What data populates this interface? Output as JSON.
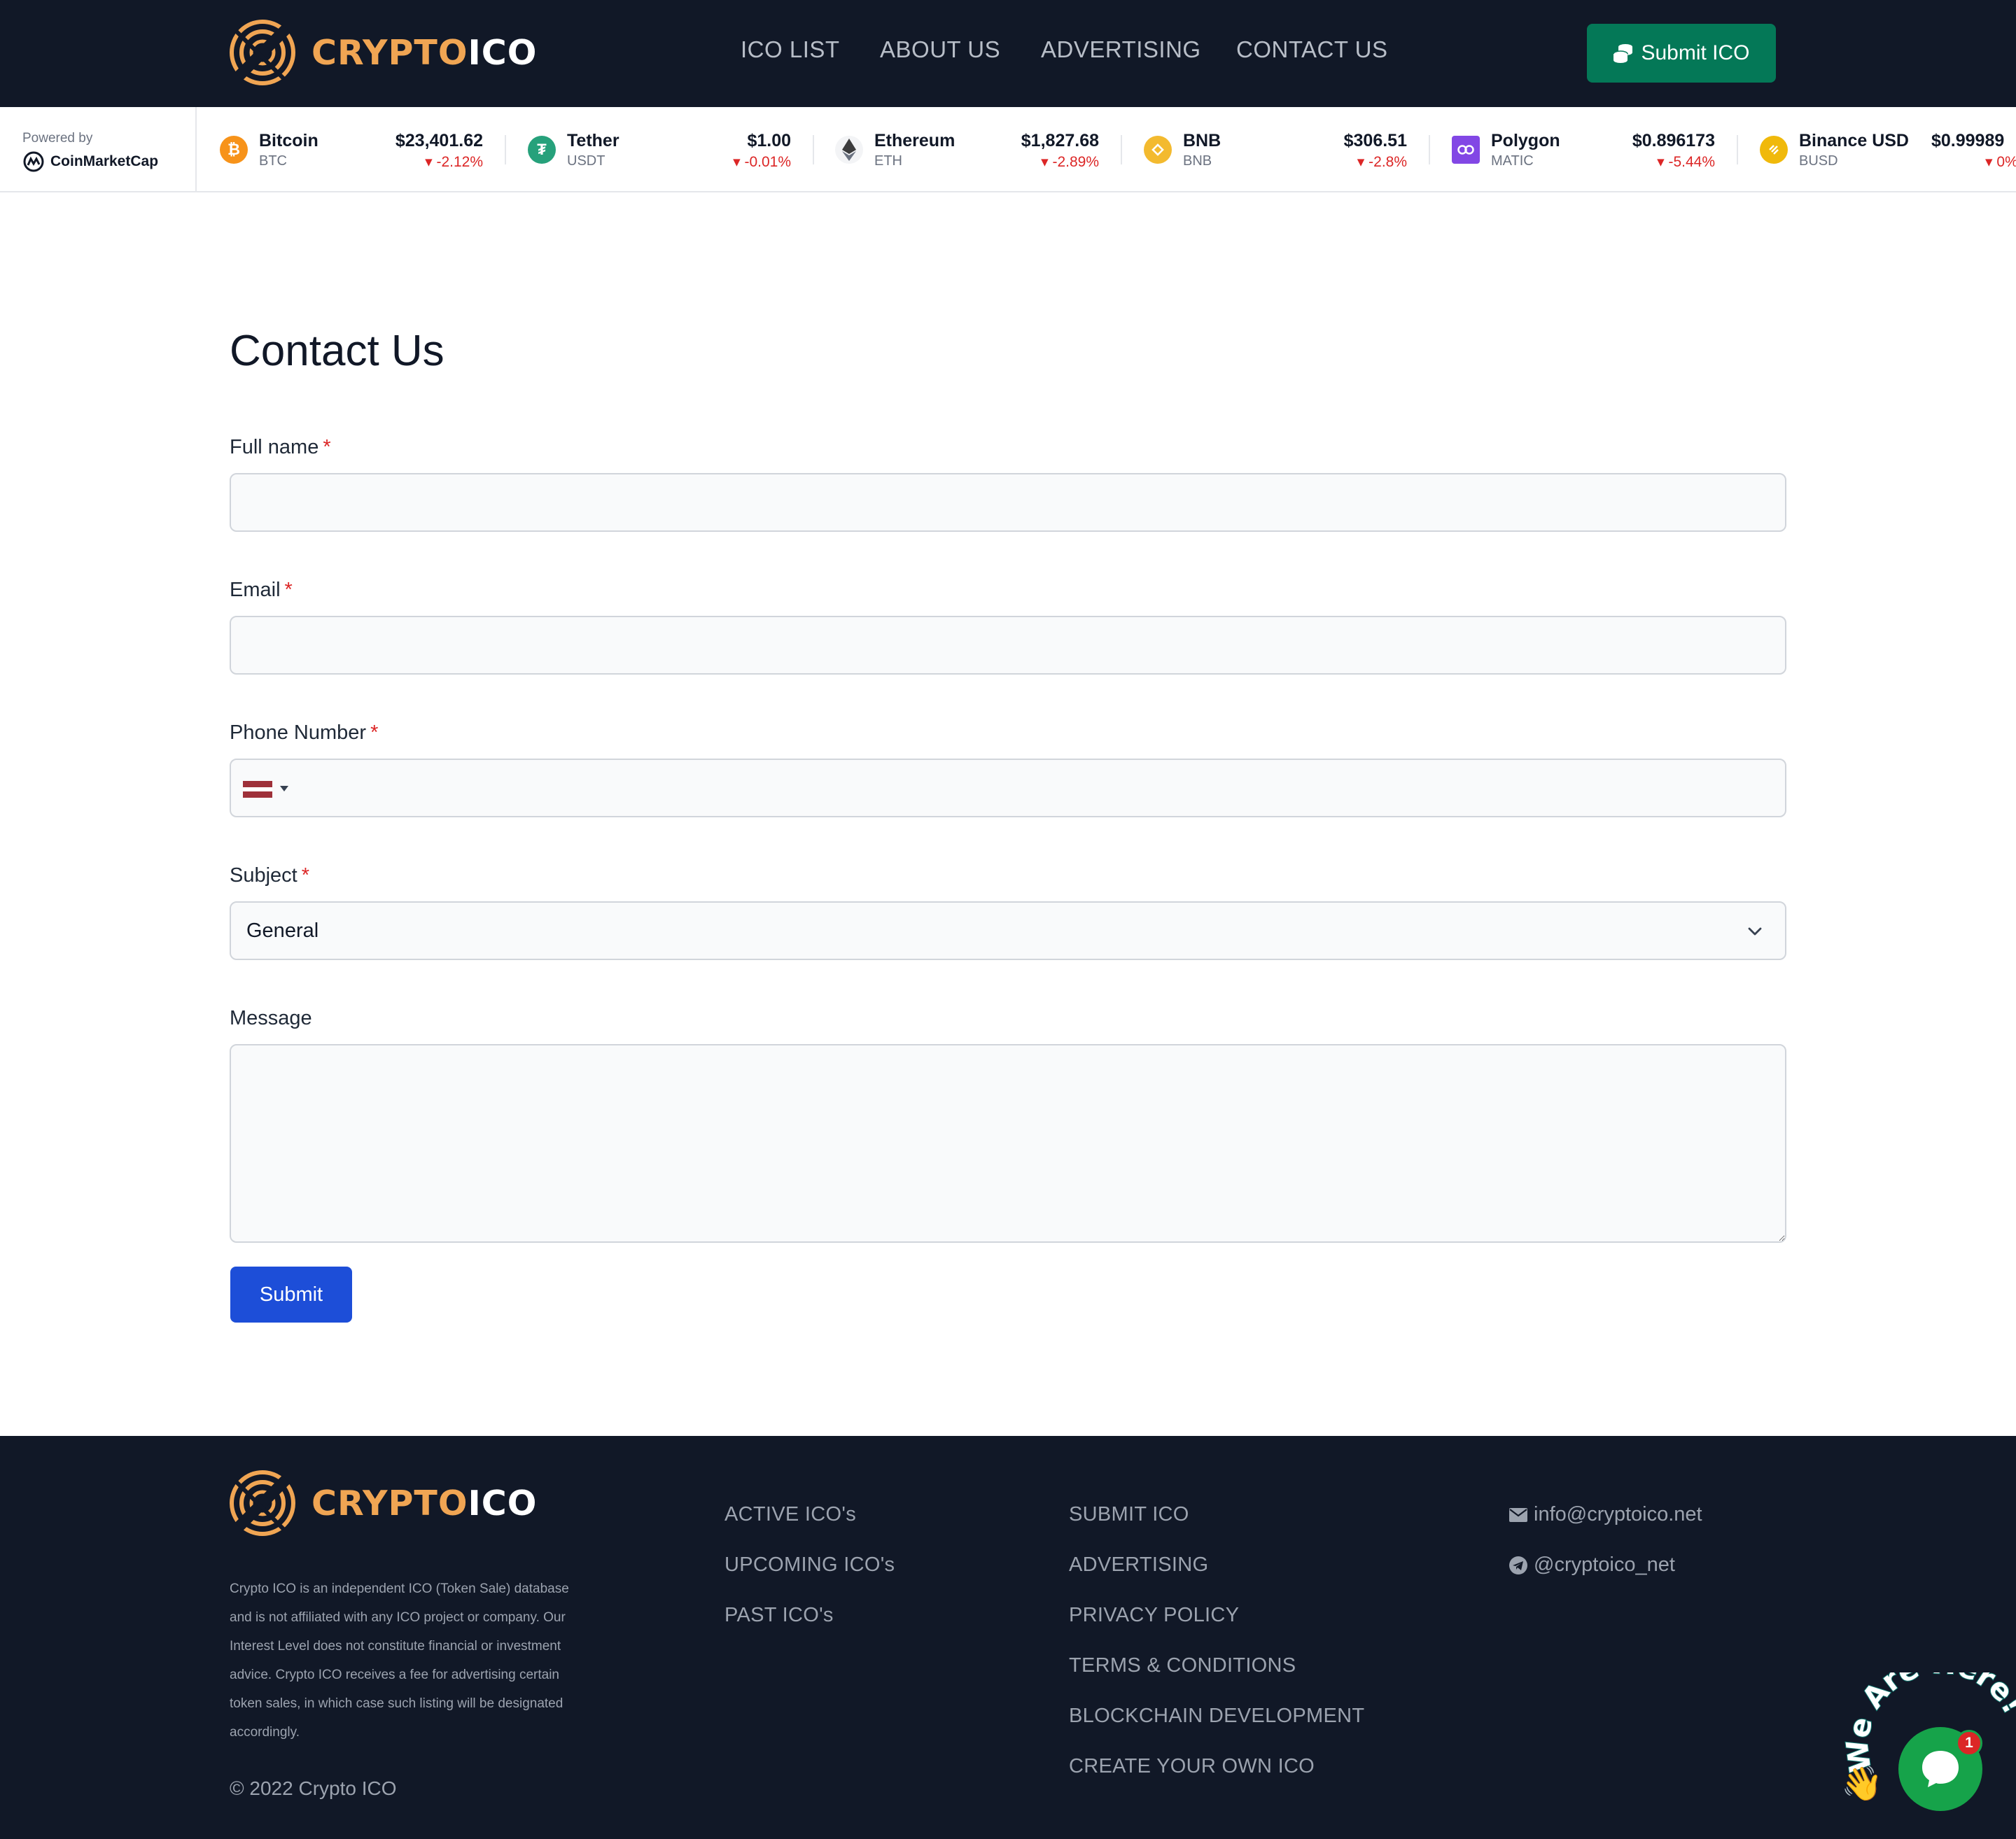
{
  "header": {
    "logo": {
      "part1": "CRYPTO",
      "part2": "ICO"
    },
    "nav": [
      {
        "label": "ICO LIST"
      },
      {
        "label": "ABOUT US"
      },
      {
        "label": "ADVERTISING"
      },
      {
        "label": "CONTACT US"
      }
    ],
    "submit_ico_label": "Submit ICO"
  },
  "ticker": {
    "powered_by": "Powered by",
    "provider": "CoinMarketCap",
    "coins": [
      {
        "name": "Bitcoin",
        "symbol": "BTC",
        "price": "$23,401.62",
        "change": "-2.12%",
        "icon": "bitcoin-icon",
        "color": "#f7931a"
      },
      {
        "name": "Tether",
        "symbol": "USDT",
        "price": "$1.00",
        "change": "-0.01%",
        "icon": "tether-icon",
        "color": "#26a17b"
      },
      {
        "name": "Ethereum",
        "symbol": "ETH",
        "price": "$1,827.68",
        "change": "-2.89%",
        "icon": "ethereum-icon",
        "color": "#3c3c3d"
      },
      {
        "name": "BNB",
        "symbol": "BNB",
        "price": "$306.51",
        "change": "-2.8%",
        "icon": "bnb-icon",
        "color": "#f3ba2f"
      },
      {
        "name": "Polygon",
        "symbol": "MATIC",
        "price": "$0.896173",
        "change": "-5.44%",
        "icon": "polygon-icon",
        "color": "#8247e5"
      },
      {
        "name": "Binance USD",
        "symbol": "BUSD",
        "price": "$0.99989",
        "change": "0%",
        "icon": "busd-icon",
        "color": "#f0b90b"
      }
    ]
  },
  "main": {
    "title": "Contact Us",
    "form": {
      "full_name_label": "Full name",
      "email_label": "Email",
      "phone_label": "Phone Number",
      "subject_label": "Subject",
      "subject_value": "General",
      "message_label": "Message",
      "required_mark": "*",
      "submit_label": "Submit"
    }
  },
  "footer": {
    "logo": {
      "part1": "CRYPTO",
      "part2": "ICO"
    },
    "description": "Crypto ICO is an independent ICO (Token Sale) database and is not affiliated with any ICO project or company. Our Interest Level does not constitute financial or investment advice. Crypto ICO receives a fee for advertising certain token sales, in which case such listing will be designated accordingly.",
    "copyright": "© 2022 Crypto ICO",
    "col1": [
      "ACTIVE ICO's",
      "UPCOMING ICO's",
      "PAST ICO's"
    ],
    "col2": [
      "SUBMIT ICO",
      "ADVERTISING",
      "PRIVACY POLICY",
      "TERMS & CONDITIONS",
      "BLOCKCHAIN DEVELOPMENT",
      "CREATE YOUR OWN ICO"
    ],
    "email": "info@cryptoico.net",
    "telegram": "@cryptoico_net"
  },
  "chat": {
    "tagline": "We Are Here!",
    "badge": "1"
  },
  "colors": {
    "header_bg": "#111827",
    "accent": "#f0a553",
    "submit_ico": "#047857",
    "submit": "#1d4ed8",
    "negative": "#dc2626"
  }
}
